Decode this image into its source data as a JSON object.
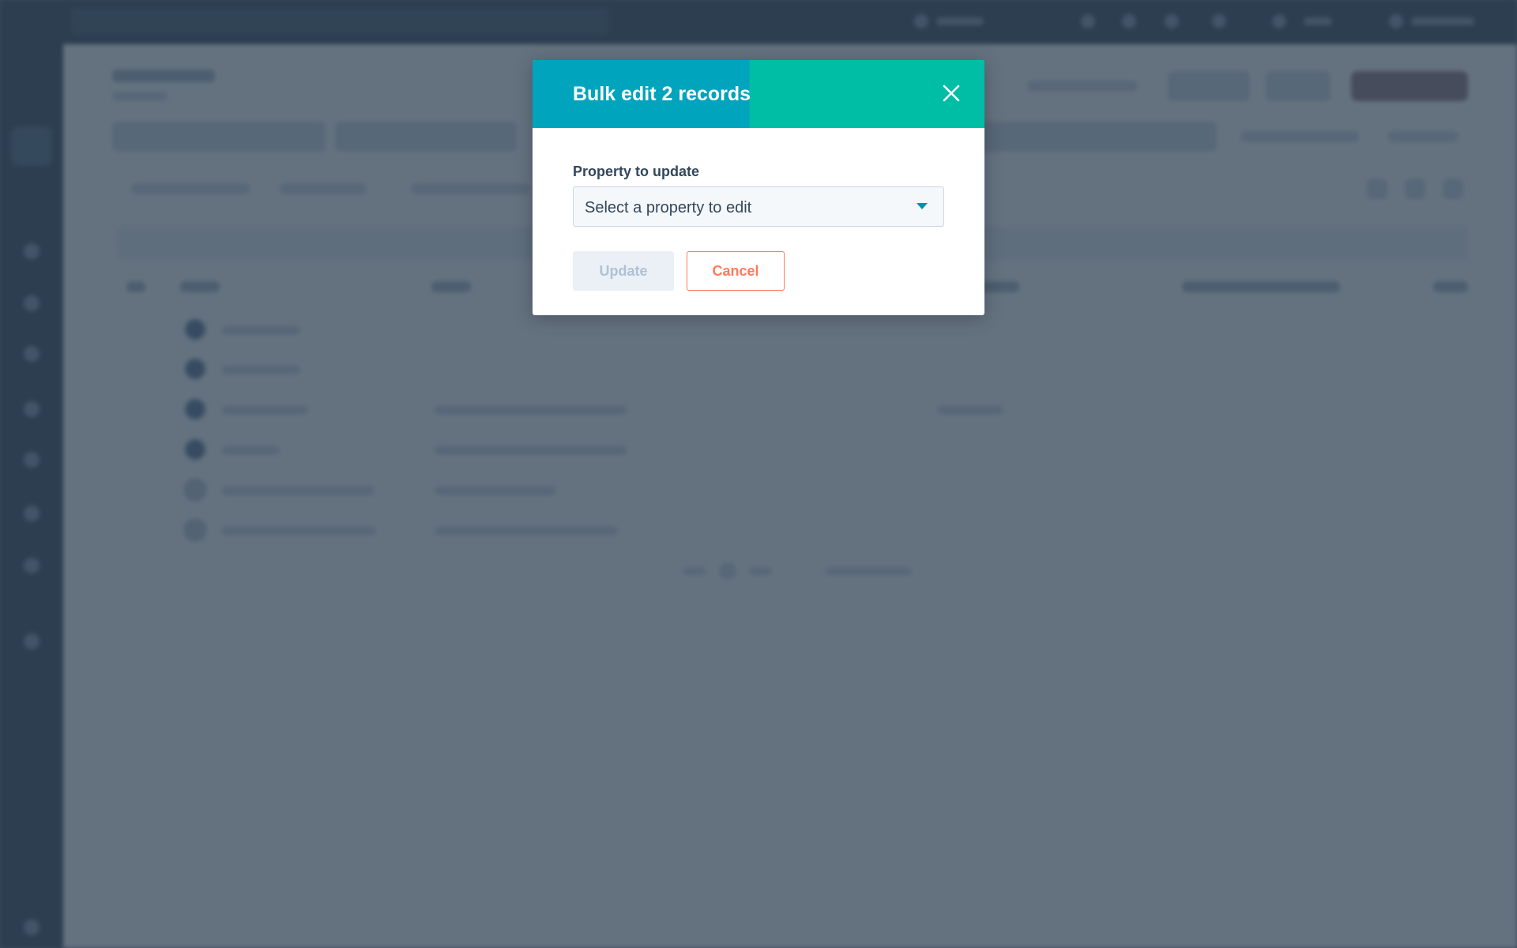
{
  "modal": {
    "title": "Bulk edit 2 records",
    "close_icon": "close-icon",
    "property_label": "Property to update",
    "property_select": {
      "value": "Select a property to edit",
      "icon": "caret-down-icon"
    },
    "update_label": "Update",
    "cancel_label": "Cancel"
  },
  "colors": {
    "header_left": "#00a4bd",
    "header_right": "#00bda5",
    "cancel_accent": "#ff7a59",
    "overlay": "#2d3e50",
    "text": "#33475b"
  }
}
